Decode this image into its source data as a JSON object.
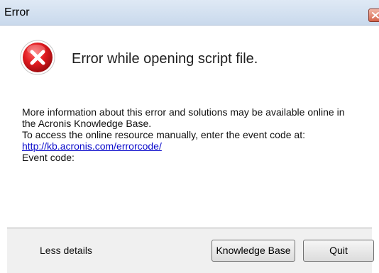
{
  "window": {
    "title": "Error",
    "close_icon": "close-x-icon"
  },
  "message": {
    "icon": "error-icon",
    "headline": "Error while opening script file."
  },
  "details": {
    "line1": "More information about this error and solutions may be available online in",
    "line2": "the Acronis Knowledge Base.",
    "line3": "To access the online resource manually, enter the event code at:",
    "link": "http://kb.acronis.com/errorcode/",
    "line4": "Event code:"
  },
  "footer": {
    "less_details_label": "Less details",
    "knowledge_base_label": "Knowledge Base",
    "quit_label": "Quit"
  },
  "colors": {
    "error_red": "#d9161c",
    "link_blue": "#0a0acb"
  }
}
